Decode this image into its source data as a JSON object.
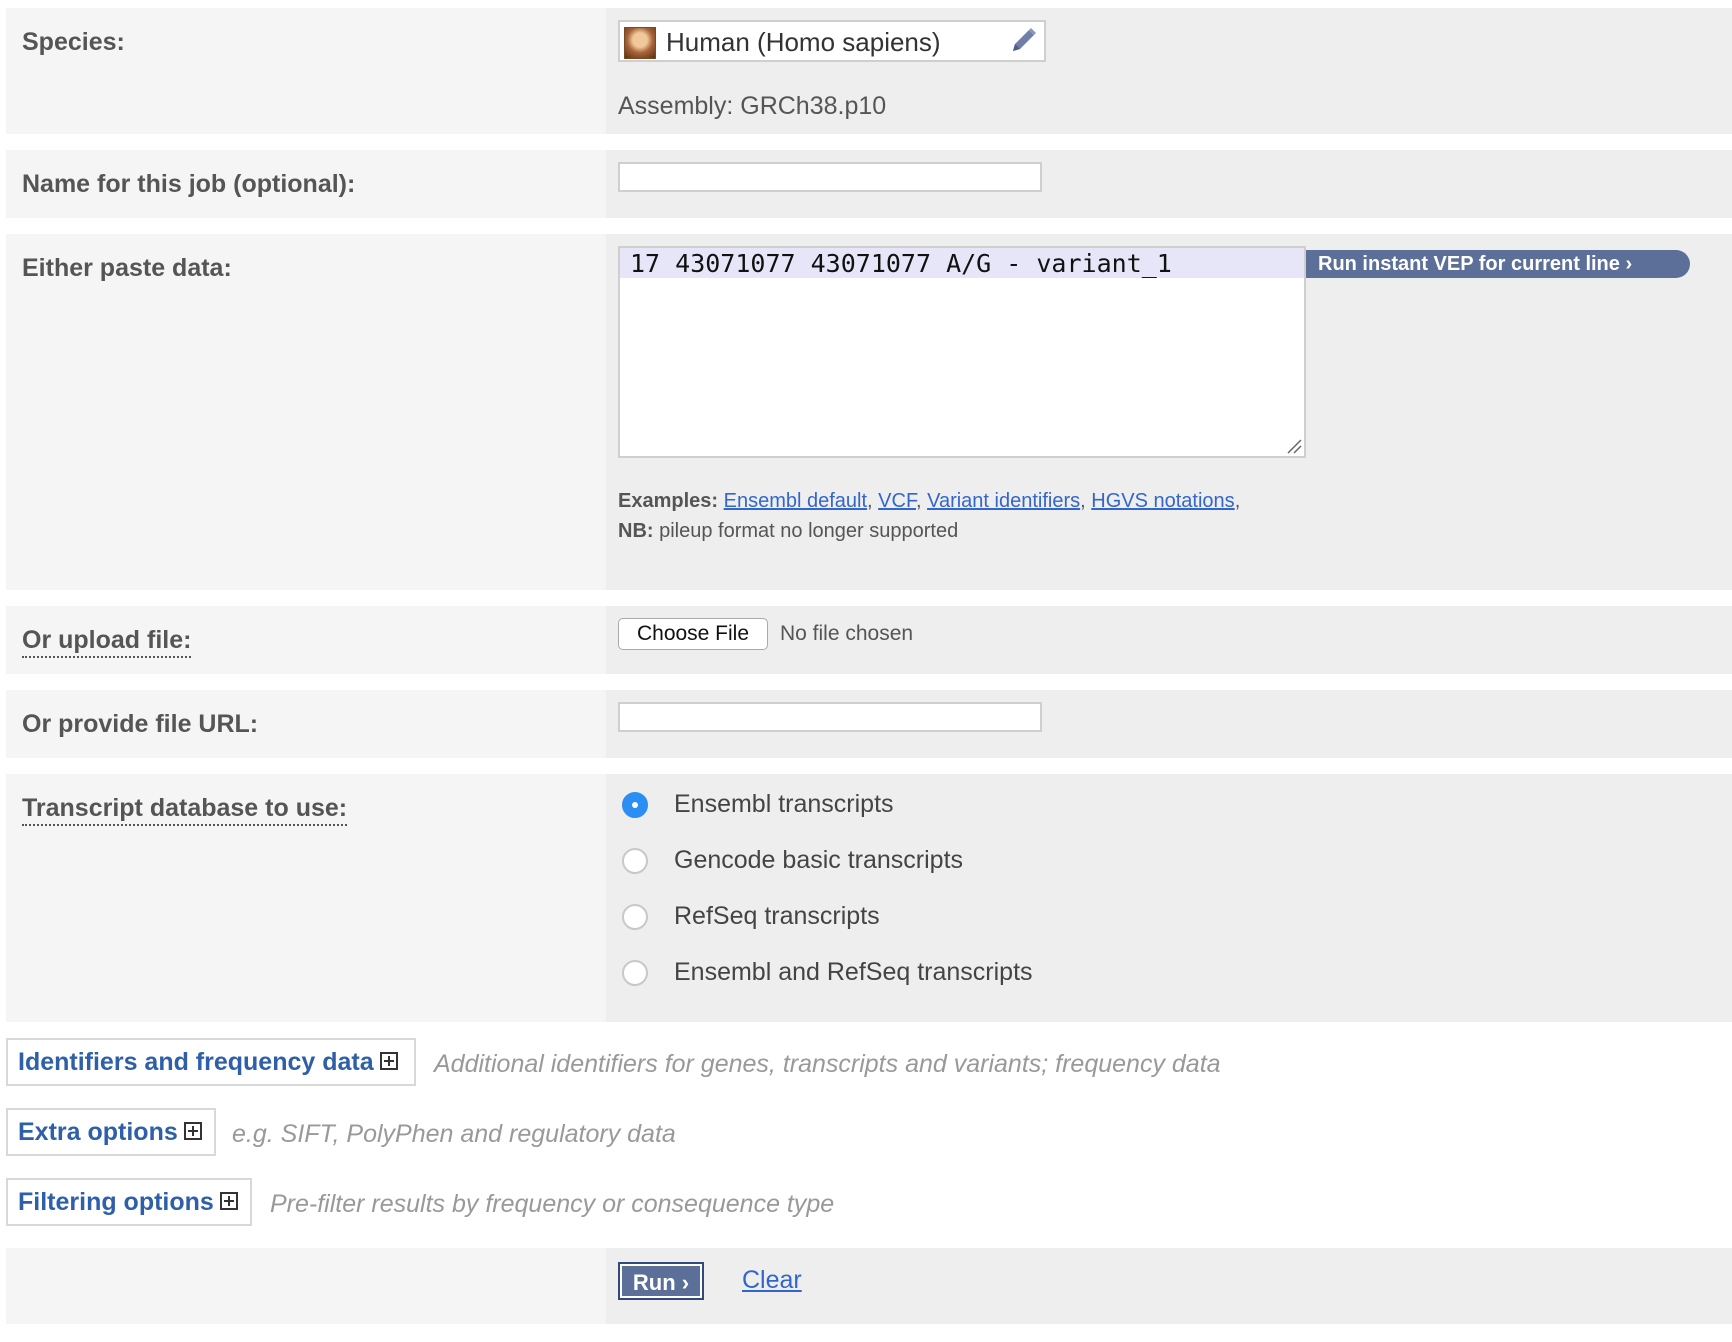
{
  "species": {
    "label": "Species:",
    "name": "Human (Homo sapiens)",
    "assembly": "Assembly: GRCh38.p10"
  },
  "job_name": {
    "label": "Name for this job (optional):",
    "value": ""
  },
  "paste": {
    "label": "Either paste data:",
    "value": "17 43071077 43071077 A/G - variant_1",
    "run_instant_label": "Run instant VEP for current line ›",
    "examples_label": "Examples:",
    "examples": [
      "Ensembl default",
      "VCF",
      "Variant identifiers",
      "HGVS notations"
    ],
    "nb_label": "NB:",
    "nb_text": "pileup format no longer supported"
  },
  "upload": {
    "label": "Or upload file:",
    "button_label": "Choose File",
    "status": "No file chosen"
  },
  "url": {
    "label": "Or provide file URL:",
    "value": ""
  },
  "transcripts": {
    "label": "Transcript database to use:",
    "options": [
      {
        "label": "Ensembl transcripts",
        "selected": true
      },
      {
        "label": "Gencode basic transcripts",
        "selected": false
      },
      {
        "label": "RefSeq transcripts",
        "selected": false
      },
      {
        "label": "Ensembl and RefSeq transcripts",
        "selected": false
      }
    ]
  },
  "sections": [
    {
      "title": "Identifiers and frequency data",
      "description": "Additional identifiers for genes, transcripts and variants; frequency data"
    },
    {
      "title": "Extra options",
      "description": "e.g. SIFT, PolyPhen and regulatory data"
    },
    {
      "title": "Filtering options",
      "description": "Pre-filter results by frequency or consequence type"
    }
  ],
  "actions": {
    "run_label": "Run ›",
    "clear_label": "Clear"
  },
  "colors": {
    "link": "#3366cc",
    "button": "#5b6f99",
    "section_title": "#2e5fa8",
    "radio_selected": "#2b8ef5"
  }
}
